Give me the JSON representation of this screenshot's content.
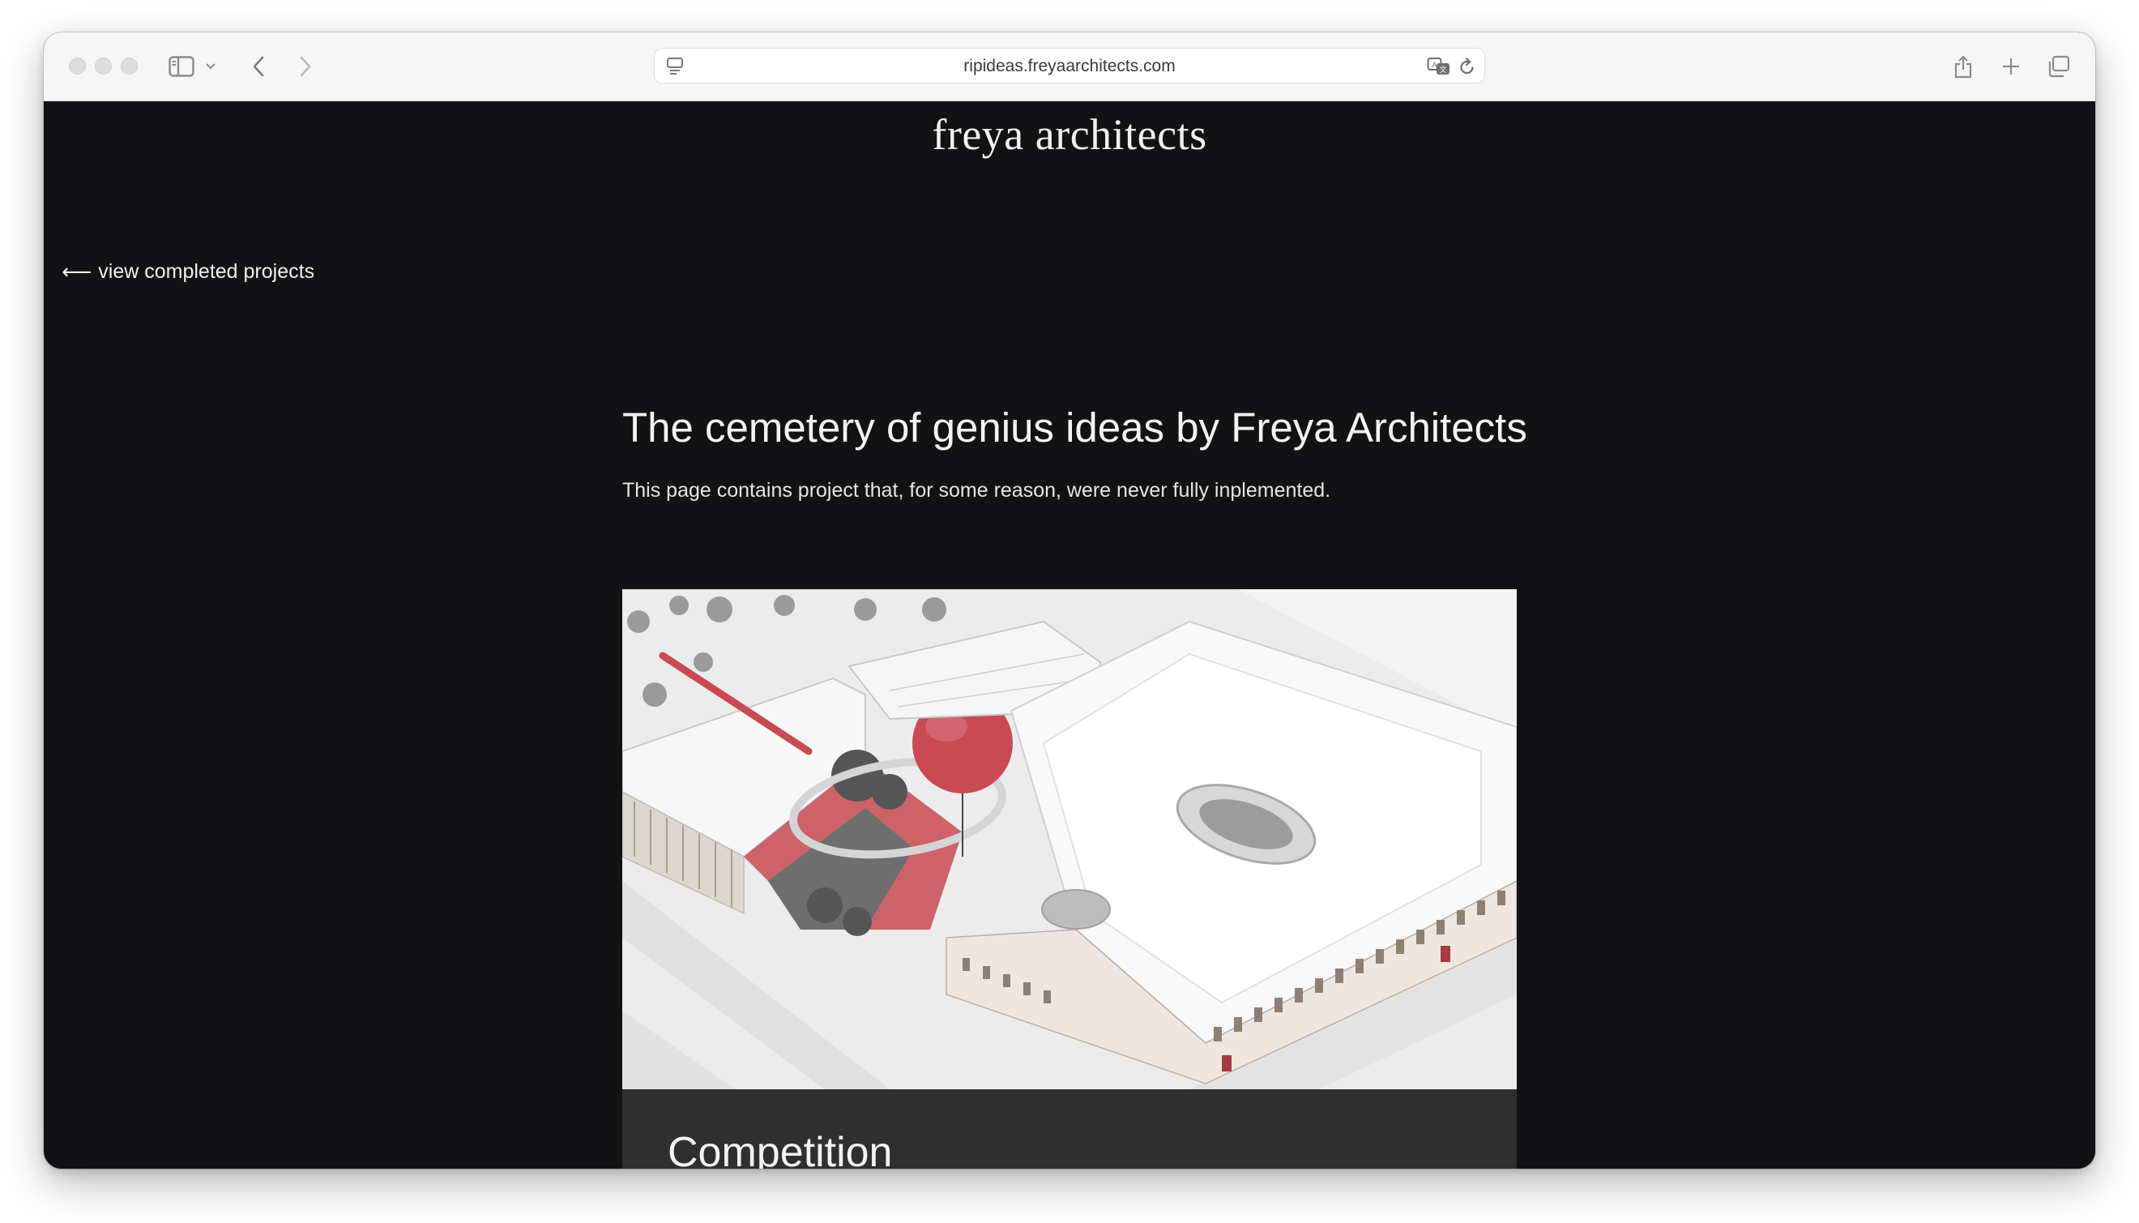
{
  "browser": {
    "url": "ripideas.freyaarchitects.com"
  },
  "site": {
    "logo": "freya architects",
    "back_link": "view completed projects",
    "back_arrow": "⟵"
  },
  "main": {
    "title": "The cemetery of genius ideas by Freya Architects",
    "subtitle": "This page contains project that, for some reason, were never fully inplemented.",
    "projects": [
      {
        "caption": "Competition"
      }
    ]
  },
  "colors": {
    "page_background": "#121214",
    "caption_background": "#2f2f30",
    "accent_red": "#c94a52"
  }
}
